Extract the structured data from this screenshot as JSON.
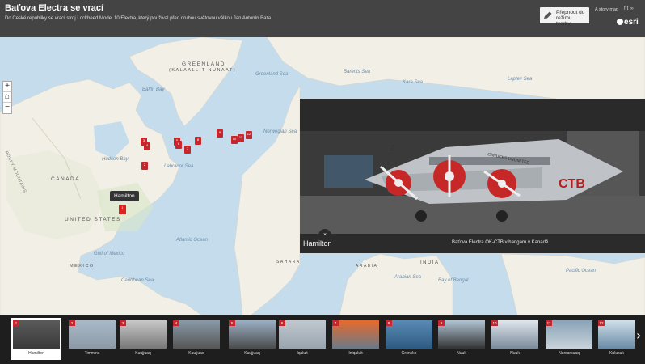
{
  "header": {
    "title": "Baťova Electra se vrací",
    "subtitle": "Do České republiky se vrací stroj Lockheed Model 10 Electra, který používal před druhou světovou válkou Jan Antonín Baťa.",
    "builder_button": "Přepnout do režimu tvorby",
    "story_map_label": "A story map",
    "share_icons": [
      "facebook-icon",
      "twitter-icon",
      "link-icon"
    ],
    "brand": "esri"
  },
  "map": {
    "labels": {
      "greenland": "GREENLAND",
      "kalaallit": "(KALAALLIT NUNAAT)",
      "canada": "CANADA",
      "united_states": "UNITED STATES",
      "mexico": "MEXICO",
      "greenland_sea": "Greenland Sea",
      "barents_sea": "Barents Sea",
      "kara_sea": "Kara Sea",
      "laptev_sea": "Laptev Sea",
      "baffin_bay": "Baffin Bay",
      "hudson_bay": "Hudson Bay",
      "labrador_sea": "Labrador Sea",
      "norwegian_sea": "Norwegian Sea",
      "atlantic_ocean": "Atlantic Ocean",
      "gulf_of_mexico": "Gulf of Mexico",
      "caribbean_sea": "Caribbean Sea",
      "sahara": "SAHARA",
      "arabia": "ARABIA",
      "india": "INDIA",
      "pacific_ocean": "Pacific Ocean",
      "bay_of_bengal": "Bay of Bengal",
      "arabian_sea": "Arabian Sea",
      "rocky_mountains": "ROCKY MOUNTAINS"
    },
    "zoom": {
      "in": "+",
      "home": "⌂",
      "out": "−"
    },
    "tooltip": "Hamilton",
    "markers": [
      "1",
      "2",
      "3",
      "4",
      "5",
      "6",
      "7",
      "8",
      "9",
      "10",
      "11",
      "12"
    ]
  },
  "media": {
    "place": "Hamilton",
    "caption": "Baťova Electra OK-CTB v hangáru v Kanadě",
    "plane_text": "CANUCKS UNLIMITED",
    "registration": "CTB"
  },
  "carousel": {
    "items": [
      {
        "num": "1",
        "label": "Hamilton"
      },
      {
        "num": "2",
        "label": "Timmins"
      },
      {
        "num": "3",
        "label": "Kuujjuaq"
      },
      {
        "num": "4",
        "label": "Kuujjuaq"
      },
      {
        "num": "5",
        "label": "Kuujjuaq"
      },
      {
        "num": "6",
        "label": "Iqaluit"
      },
      {
        "num": "7",
        "label": "Iniqaluit"
      },
      {
        "num": "8",
        "label": "Grónsko"
      },
      {
        "num": "9",
        "label": "Nuuk"
      },
      {
        "num": "10",
        "label": "Nuuk"
      },
      {
        "num": "11",
        "label": "Narsarsuaq"
      },
      {
        "num": "12",
        "label": "Kulusuk"
      }
    ],
    "next_label": "›"
  }
}
